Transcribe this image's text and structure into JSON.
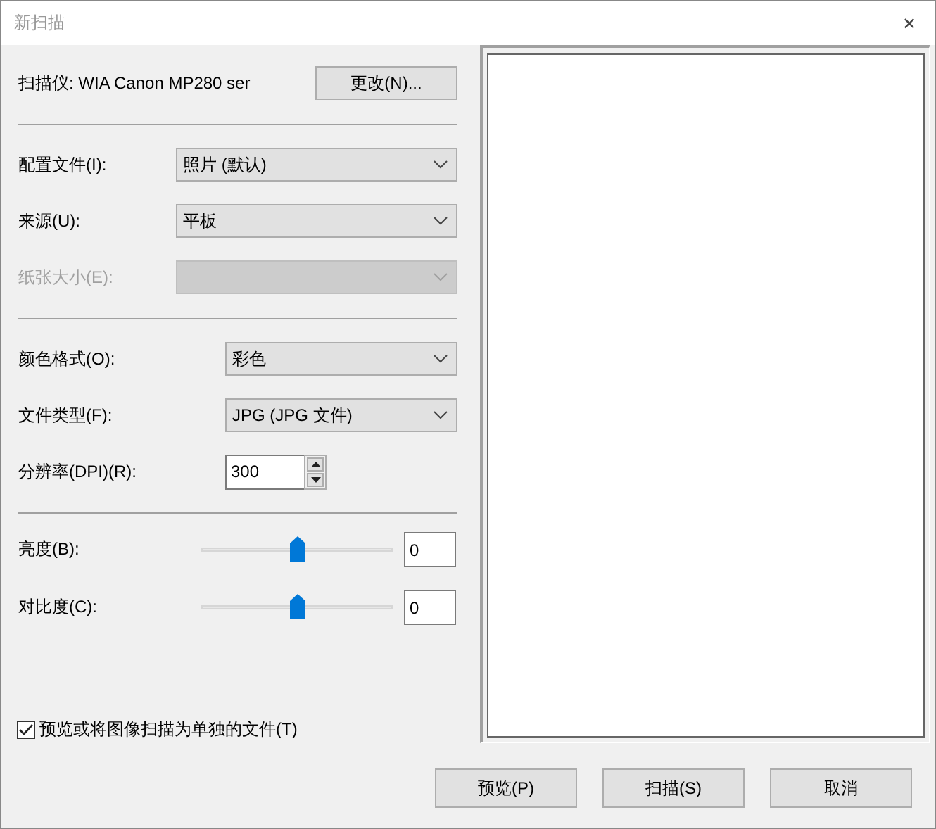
{
  "window": {
    "title": "新扫描",
    "close": "✕"
  },
  "scanner": {
    "label": "扫描仪: WIA Canon MP280 ser",
    "button": "更改(N)..."
  },
  "sections": [
    {
      "rows": [
        {
          "kind": "dropdown",
          "label": "配置文件(I):",
          "value": "照片 (默认)",
          "disabled": false
        },
        {
          "kind": "dropdown",
          "label": "来源(U):",
          "value": "平板",
          "disabled": false
        },
        {
          "kind": "dropdown",
          "label": "纸张大小(E):",
          "disabled": true
        }
      ]
    },
    {
      "rows": [
        {
          "kind": "dropdown",
          "label": "颜色格式(O):",
          "value": "彩色",
          "disabled": false
        },
        {
          "kind": "dropdown",
          "label": "文件类型(F):",
          "value": "JPG (JPG 文件)",
          "disabled": false
        },
        {
          "kind": "spinner",
          "label": "分辨率(DPI)(R):",
          "value": "300",
          "disabled": false
        }
      ]
    },
    {
      "rows": [
        {
          "kind": "slider",
          "label": "亮度(B):",
          "level": 0.5,
          "value": "0",
          "disabled": false
        },
        {
          "kind": "slider",
          "label": "对比度(C):",
          "level": 0.5,
          "value": "0",
          "disabled": false
        }
      ]
    }
  ],
  "separate_files": {
    "label": "预览或将图像扫描为单独的文件(T)",
    "checked": true
  },
  "buttons": [
    "预览(P)",
    "扫描(S)",
    "取消"
  ]
}
